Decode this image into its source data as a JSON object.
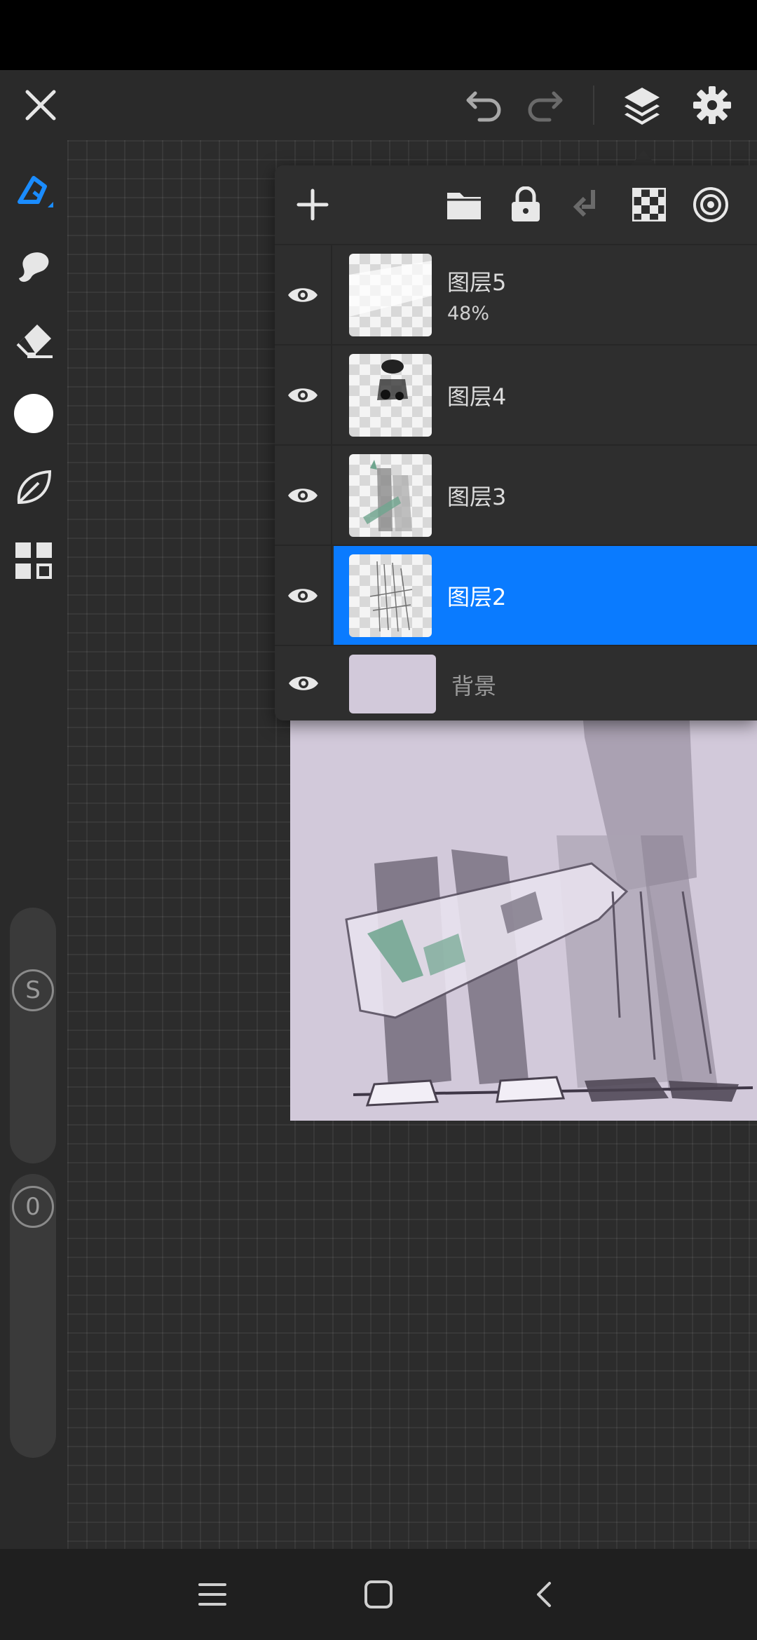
{
  "icons": {
    "close": "close-icon",
    "undo": "undo-icon",
    "redo": "redo-icon",
    "layers": "layers-icon",
    "settings": "gear-icon",
    "brush": "brush-icon",
    "smudge": "smudge-icon",
    "eraser": "eraser-icon",
    "color": "color-circle-icon",
    "selection": "leaf-select-icon",
    "transform": "grid-transform-icon",
    "add_layer": "plus-icon",
    "folder": "folder-icon",
    "lock": "lock-icon",
    "merge_down": "merge-down-icon",
    "alpha": "checker-icon",
    "clipping": "target-icon",
    "visibility": "eye-icon"
  },
  "sliders": {
    "size_label": "S",
    "opacity_label": "0"
  },
  "layers": [
    {
      "name": "图层5",
      "opacity": "48%",
      "visible": true,
      "selected": false
    },
    {
      "name": "图层4",
      "visible": true,
      "selected": false
    },
    {
      "name": "图层3",
      "visible": true,
      "selected": false
    },
    {
      "name": "图层2",
      "visible": true,
      "selected": true
    },
    {
      "name": "背景",
      "visible": true,
      "selected": false,
      "background_color": "#d2c9da"
    }
  ],
  "colors": {
    "accent": "#0a7bff",
    "canvas_paper": "#d2c9da",
    "panel": "#2e2e2e",
    "toolbar": "#2a2a2a"
  },
  "nav": {
    "menu": "menu-icon",
    "home": "home-icon",
    "back": "back-icon"
  }
}
